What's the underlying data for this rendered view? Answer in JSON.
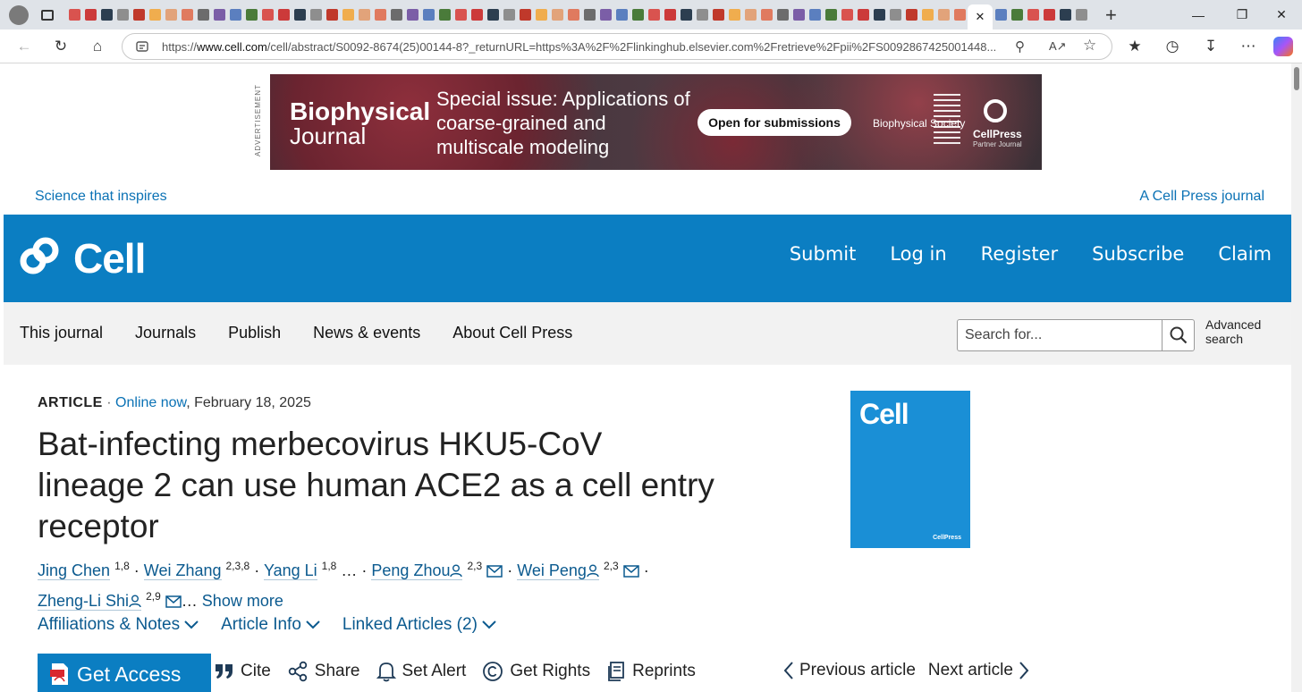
{
  "browser": {
    "close_tab_glyph": "✕",
    "new_tab_glyph": "+",
    "url_prefix": "https://",
    "url_host": "www.cell.com",
    "url_path": "/cell/abstract/S0092-8674(25)00144-8?_returnURL=https%3A%2F%2Flinkinghub.elsevier.com%2Fretrieve%2Fpii%2FS0092867425001448..."
  },
  "ad": {
    "label": "ADVERTISEMENT",
    "journal_line1": "Biophysical",
    "journal_line2": "Journal",
    "issue_text": "Special issue: Applications of coarse-grained and multiscale modeling",
    "cta": "Open for submissions",
    "society": "Biophysical Society",
    "partner": "CellPress",
    "partner_sub": "Partner Journal"
  },
  "site": {
    "tagline_left": "Science that inspires",
    "tagline_right": "A Cell Press journal",
    "logo": "Cell",
    "top_nav": [
      "Submit",
      "Log in",
      "Register",
      "Subscribe",
      "Claim"
    ],
    "sub_nav": [
      "This journal",
      "Journals",
      "Publish",
      "News & events",
      "About Cell Press"
    ],
    "search": {
      "placeholder": "Search for...",
      "advanced": "Advanced search"
    }
  },
  "article": {
    "type": "ARTICLE",
    "separator": " · ",
    "status": "Online now",
    "date": ", February 18, 2025",
    "title": "Bat-infecting merbecovirus HKU5-CoV lineage 2 can use human ACE2 as a cell entry receptor",
    "authors": [
      {
        "name": "Jing Chen",
        "sup": "1,8"
      },
      {
        "name": "Wei Zhang",
        "sup": "2,3,8"
      },
      {
        "name": "Yang Li",
        "sup": "1,8"
      },
      {
        "name": "Peng Zhou",
        "sup": "2,3"
      },
      {
        "name": "Wei Peng",
        "sup": "2,3"
      },
      {
        "name": "Zheng-Li Shi",
        "sup": "2,9"
      }
    ],
    "ellipsis": "…",
    "show_more": "Show more",
    "info_tabs": [
      "Affiliations & Notes",
      "Article Info",
      "Linked Articles (2)"
    ],
    "get_access": "Get Access",
    "actions": [
      "Cite",
      "Share",
      "Set Alert",
      "Get Rights",
      "Reprints"
    ],
    "prev": "Previous article",
    "next": "Next article",
    "cover_title": "Cell",
    "cover_publisher": "CellPress"
  },
  "colors": {
    "brand_blue": "#0b7ec2",
    "link_blue": "#0b5a8f"
  }
}
